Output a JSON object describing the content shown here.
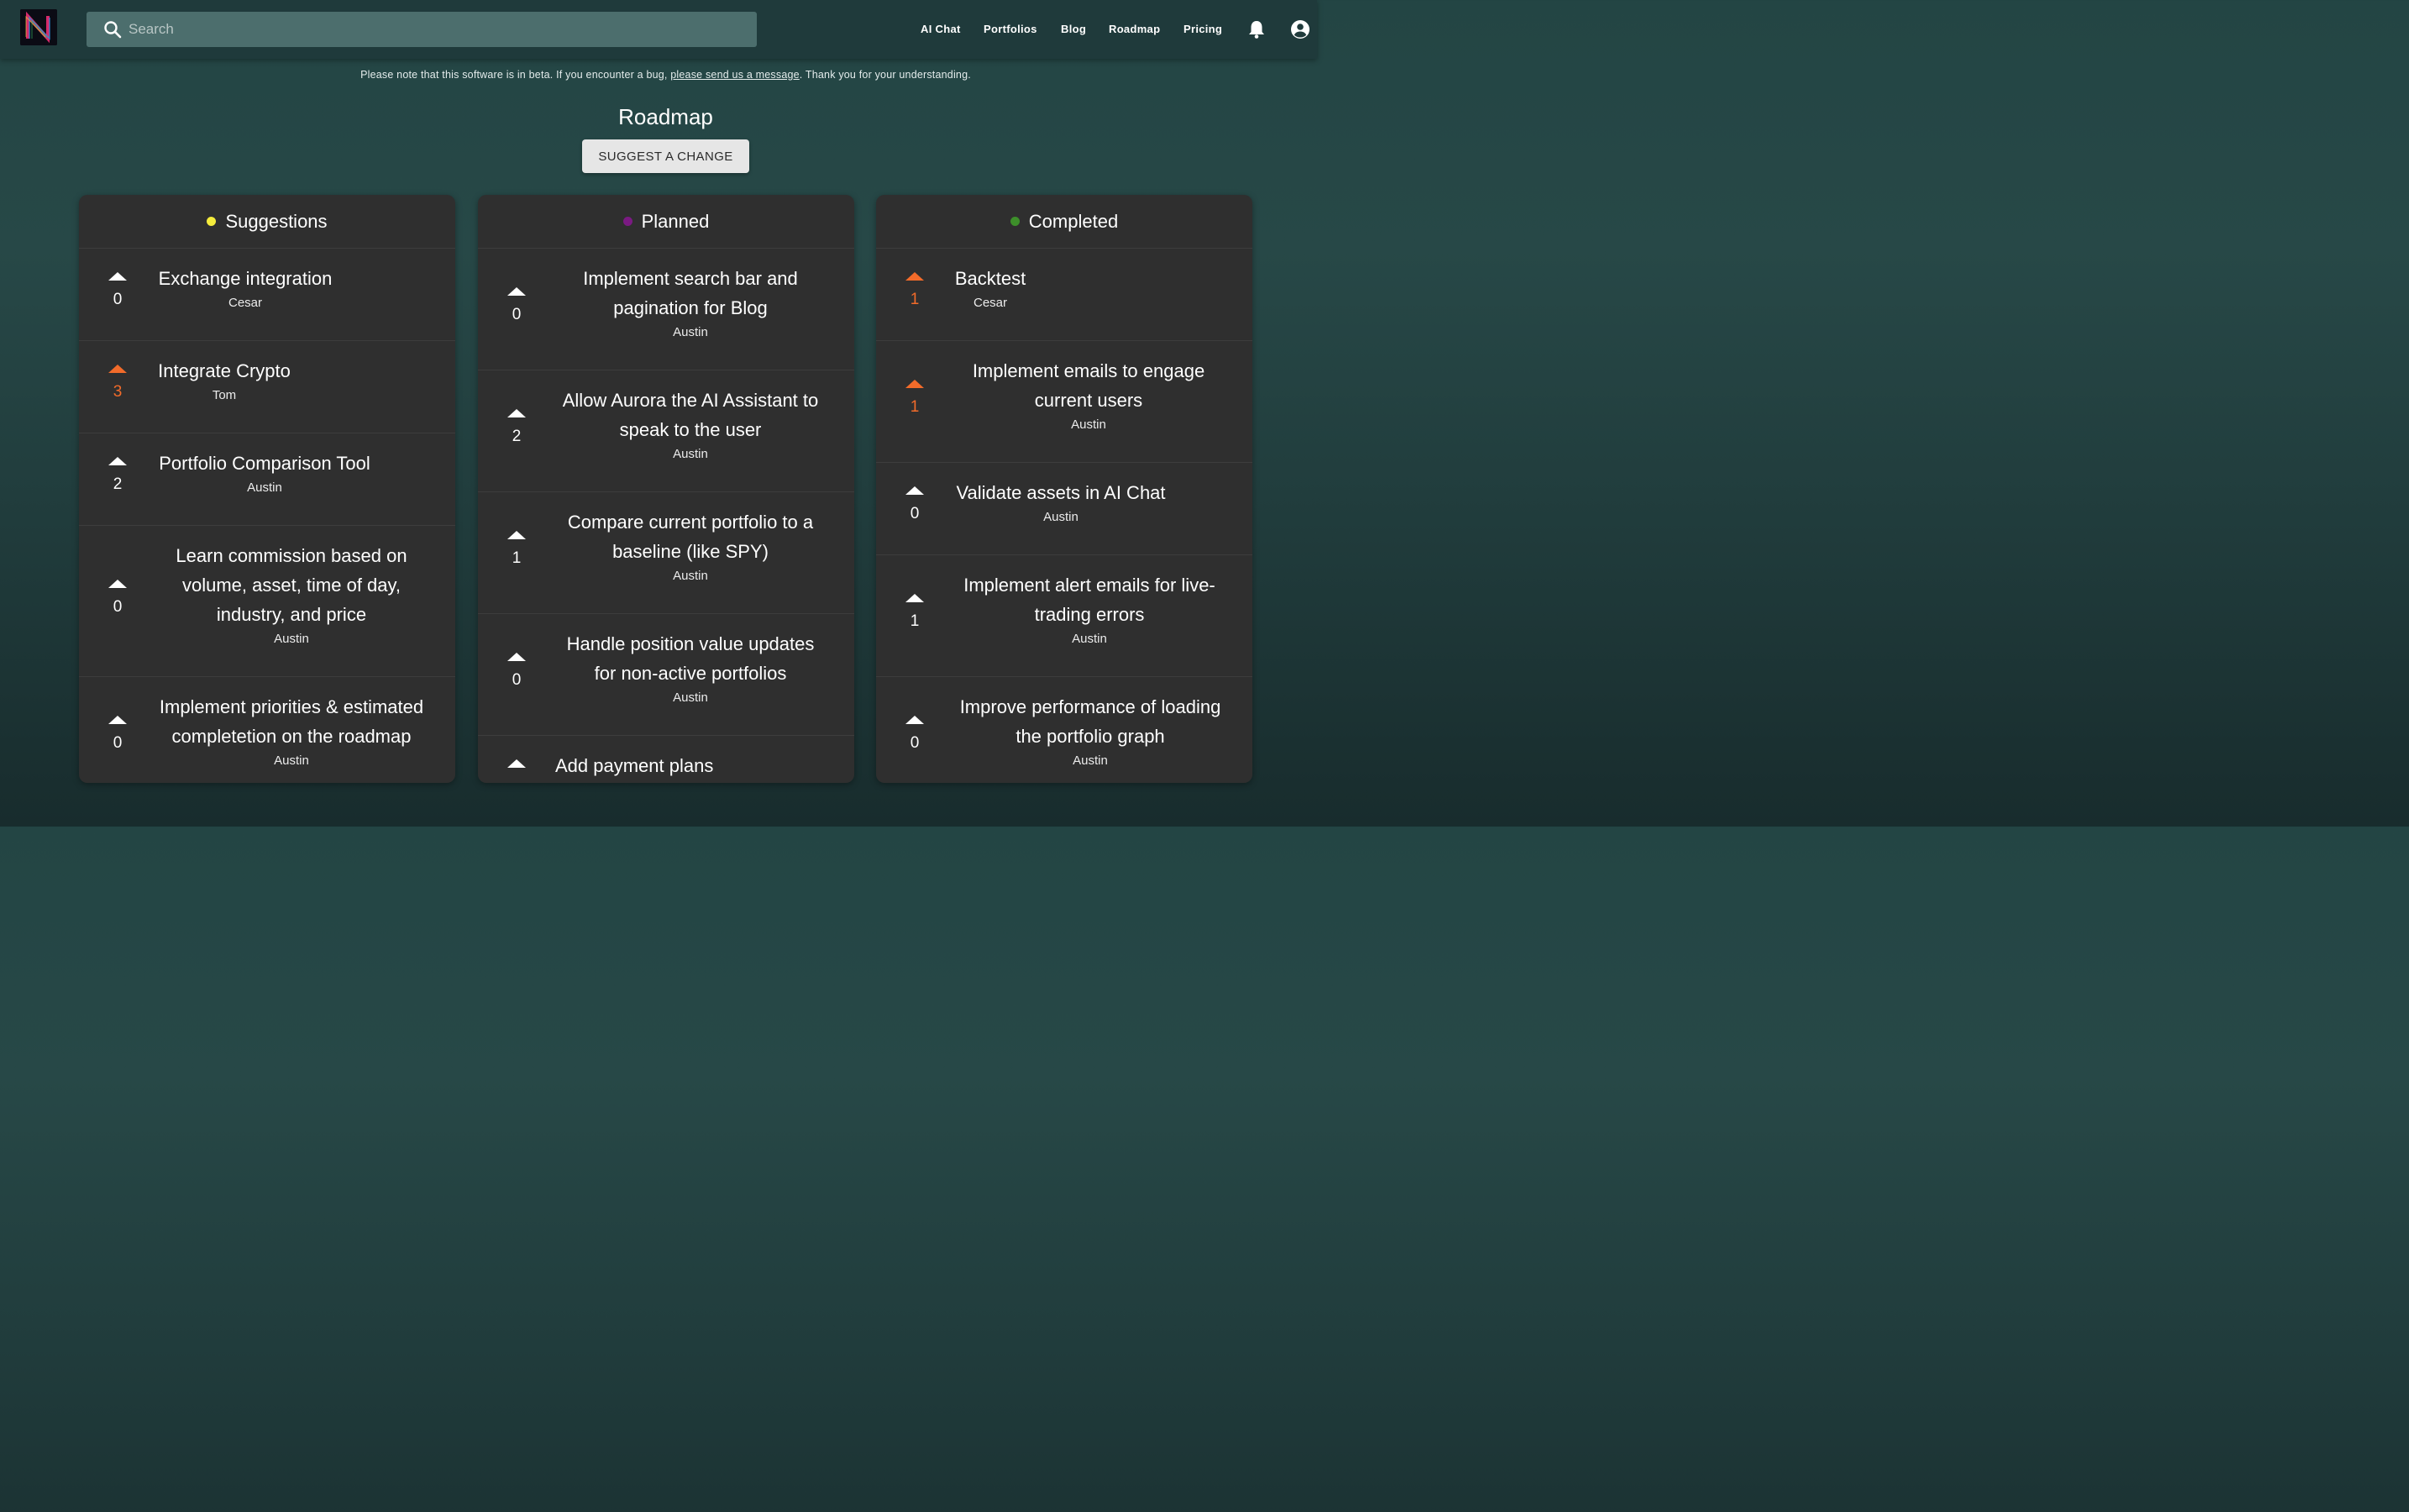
{
  "nav": {
    "search_placeholder": "Search",
    "links": [
      "AI Chat",
      "Portfolios",
      "Blog",
      "Roadmap",
      "Pricing"
    ]
  },
  "notice": {
    "before": "Please note that this software is in beta. If you encounter a bug, ",
    "link": "please send us a message",
    "after": ". Thank you for your understanding."
  },
  "page": {
    "title": "Roadmap",
    "suggest_button": "SUGGEST A CHANGE"
  },
  "colors": {
    "suggestions_dot": "#f5ec3c",
    "planned_dot": "#7a1a82",
    "completed_dot": "#3d8f2a",
    "upvoted": "#f26b2a"
  },
  "columns": [
    {
      "title": "Suggestions",
      "items": [
        {
          "title": "Exchange integration",
          "author": "Cesar",
          "votes": "0",
          "upvoted": false
        },
        {
          "title": "Integrate Crypto",
          "author": "Tom",
          "votes": "3",
          "upvoted": true
        },
        {
          "title": "Portfolio Comparison Tool",
          "author": "Austin",
          "votes": "2",
          "upvoted": false
        },
        {
          "title": "Learn commission based on volume, asset, time of day, industry, and price",
          "author": "Austin",
          "votes": "0",
          "upvoted": false
        },
        {
          "title": "Implement priorities & estimated completetion on the roadmap",
          "author": "Austin",
          "votes": "0",
          "upvoted": false
        }
      ]
    },
    {
      "title": "Planned",
      "items": [
        {
          "title": "Implement search bar and pagination for Blog",
          "author": "Austin",
          "votes": "0",
          "upvoted": false
        },
        {
          "title": "Allow Aurora the AI Assistant to speak to the user",
          "author": "Austin",
          "votes": "2",
          "upvoted": false
        },
        {
          "title": "Compare current portfolio to a baseline (like SPY)",
          "author": "Austin",
          "votes": "1",
          "upvoted": false
        },
        {
          "title": "Handle position value updates for non-active portfolios",
          "author": "Austin",
          "votes": "0",
          "upvoted": false
        },
        {
          "title": "Add payment plans",
          "author": "",
          "votes": "",
          "upvoted": false
        }
      ]
    },
    {
      "title": "Completed",
      "items": [
        {
          "title": "Backtest",
          "author": "Cesar",
          "votes": "1",
          "upvoted": true
        },
        {
          "title": "Implement emails to engage current users",
          "author": "Austin",
          "votes": "1",
          "upvoted": true
        },
        {
          "title": "Validate assets in AI Chat",
          "author": "Austin",
          "votes": "0",
          "upvoted": false
        },
        {
          "title": "Implement alert emails for live-trading errors",
          "author": "Austin",
          "votes": "1",
          "upvoted": false
        },
        {
          "title": "Improve performance of loading the portfolio graph",
          "author": "Austin",
          "votes": "0",
          "upvoted": false
        }
      ]
    }
  ]
}
